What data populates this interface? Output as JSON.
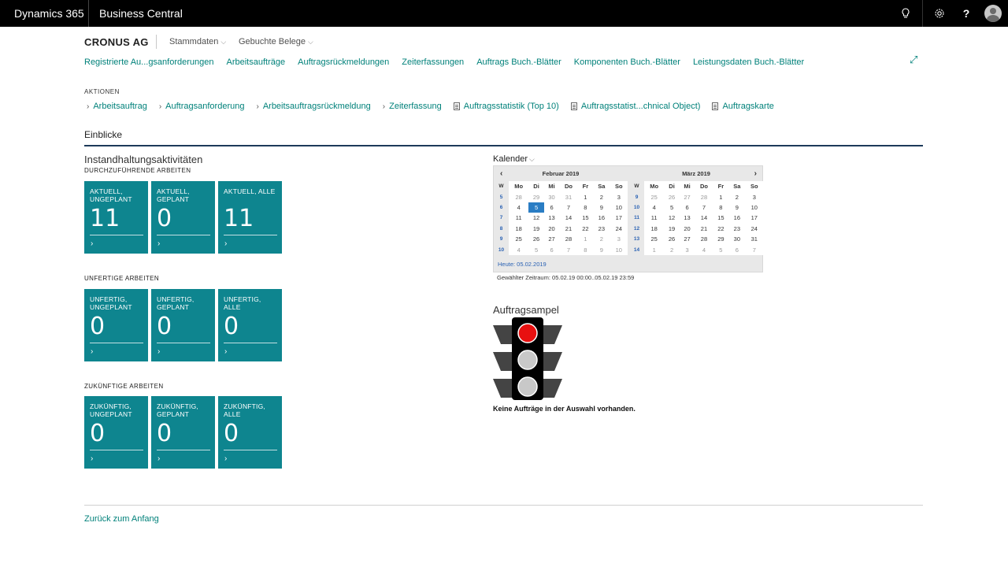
{
  "topbar": {
    "brand": "Dynamics 365",
    "product": "Business Central"
  },
  "header": {
    "company": "CRONUS AG",
    "menus": [
      "Stammdaten",
      "Gebuchte Belege"
    ],
    "navlinks": [
      "Registrierte Au...gsanforderungen",
      "Arbeitsaufträge",
      "Auftragsrückmeldungen",
      "Zeiterfassungen",
      "Auftrags Buch.-Blätter",
      "Komponenten Buch.-Blätter",
      "Leistungsdaten Buch.-Blätter"
    ]
  },
  "actions": {
    "title": "AKTIONEN",
    "items": [
      {
        "label": "Arbeitsauftrag",
        "icon": "chevron-right-icon"
      },
      {
        "label": "Auftragsanforderung",
        "icon": "chevron-right-icon"
      },
      {
        "label": "Arbeitsauftragsrückmeldung",
        "icon": "chevron-right-icon"
      },
      {
        "label": "Zeiterfassung",
        "icon": "chevron-right-icon"
      },
      {
        "label": "Auftragsstatistik (Top 10)",
        "icon": "document-icon"
      },
      {
        "label": "Auftragsstatist...chnical Object)",
        "icon": "document-icon"
      },
      {
        "label": "Auftragskarte",
        "icon": "document-icon"
      }
    ]
  },
  "insights": {
    "title": "Einblicke"
  },
  "activities": {
    "title": "Instandhaltungsaktivitäten",
    "groups": [
      {
        "title": "DURCHZUFÜHRENDE ARBEITEN",
        "tiles": [
          {
            "label": "AKTUELL, UNGEPLANT",
            "value": "11"
          },
          {
            "label": "AKTUELL, GEPLANT",
            "value": "0"
          },
          {
            "label": "AKTUELL, ALLE",
            "value": "11"
          }
        ]
      },
      {
        "title": "UNFERTIGE ARBEITEN",
        "tiles": [
          {
            "label": "UNFERTIG, UNGEPLANT",
            "value": "0"
          },
          {
            "label": "UNFERTIG, GEPLANT",
            "value": "0"
          },
          {
            "label": "UNFERTIG, ALLE",
            "value": "0"
          }
        ]
      },
      {
        "title": "ZUKÜNFTIGE ARBEITEN",
        "tiles": [
          {
            "label": "ZUKÜNFTIG, UNGEPLANT",
            "value": "0"
          },
          {
            "label": "ZUKÜNFTIG, GEPLANT",
            "value": "0"
          },
          {
            "label": "ZUKÜNFTIG, ALLE",
            "value": "0"
          }
        ]
      }
    ],
    "tile_color": "#0e858f"
  },
  "calendar": {
    "title": "Kalender",
    "weekday_headers": [
      "W",
      "Mo",
      "Di",
      "Mi",
      "Do",
      "Fr",
      "Sa",
      "So"
    ],
    "months": [
      {
        "name": "Februar 2019",
        "weeks": [
          {
            "w": "5",
            "days": [
              "28",
              "29",
              "30",
              "31",
              "1",
              "2",
              "3"
            ],
            "other": [
              0,
              1,
              2,
              3
            ]
          },
          {
            "w": "6",
            "days": [
              "4",
              "5",
              "6",
              "7",
              "8",
              "9",
              "10"
            ],
            "selected": 1
          },
          {
            "w": "7",
            "days": [
              "11",
              "12",
              "13",
              "14",
              "15",
              "16",
              "17"
            ]
          },
          {
            "w": "8",
            "days": [
              "18",
              "19",
              "20",
              "21",
              "22",
              "23",
              "24"
            ]
          },
          {
            "w": "9",
            "days": [
              "25",
              "26",
              "27",
              "28",
              "1",
              "2",
              "3"
            ],
            "other": [
              4,
              5,
              6
            ]
          },
          {
            "w": "10",
            "days": [
              "4",
              "5",
              "6",
              "7",
              "8",
              "9",
              "10"
            ],
            "other": [
              0,
              1,
              2,
              3,
              4,
              5,
              6
            ]
          }
        ]
      },
      {
        "name": "März 2019",
        "weeks": [
          {
            "w": "9",
            "days": [
              "25",
              "26",
              "27",
              "28",
              "1",
              "2",
              "3"
            ],
            "other": [
              0,
              1,
              2,
              3
            ]
          },
          {
            "w": "10",
            "days": [
              "4",
              "5",
              "6",
              "7",
              "8",
              "9",
              "10"
            ]
          },
          {
            "w": "11",
            "days": [
              "11",
              "12",
              "13",
              "14",
              "15",
              "16",
              "17"
            ]
          },
          {
            "w": "12",
            "days": [
              "18",
              "19",
              "20",
              "21",
              "22",
              "23",
              "24"
            ]
          },
          {
            "w": "13",
            "days": [
              "25",
              "26",
              "27",
              "28",
              "29",
              "30",
              "31"
            ]
          },
          {
            "w": "14",
            "days": [
              "1",
              "2",
              "3",
              "4",
              "5",
              "6",
              "7"
            ],
            "other": [
              0,
              1,
              2,
              3,
              4,
              5,
              6
            ]
          }
        ]
      }
    ],
    "today": "Heute: 05.02.2019",
    "range": "Gewählter Zeitraum: 05.02.19 00:00..05.02.19 23:59"
  },
  "ampel": {
    "title": "Auftragsampel",
    "message": "Keine Aufträge in der Auswahl vorhanden.",
    "lights": [
      "red",
      "off",
      "off"
    ],
    "colors": {
      "red": "#e81010",
      "off": "#c8c8c8"
    }
  },
  "footer": {
    "back": "Zurück zum Anfang"
  }
}
